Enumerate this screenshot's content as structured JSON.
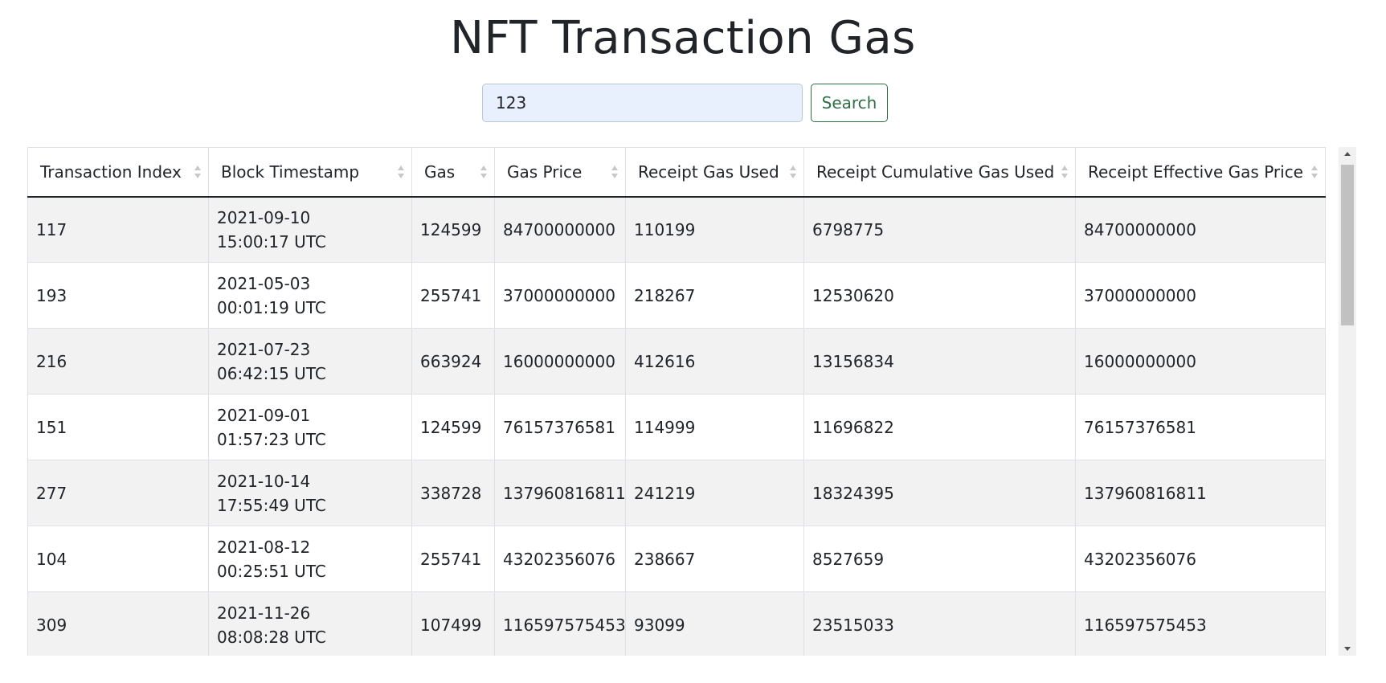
{
  "page": {
    "title": "NFT Transaction Gas"
  },
  "search": {
    "value": "123",
    "button_label": "Search"
  },
  "table": {
    "columns": [
      "Transaction Index",
      "Block Timestamp",
      "Gas",
      "Gas Price",
      "Receipt Gas Used",
      "Receipt Cumulative Gas Used",
      "Receipt Effective Gas Price"
    ],
    "rows": [
      [
        "117",
        "2021-09-10 15:00:17 UTC",
        "124599",
        "84700000000",
        "110199",
        "6798775",
        "84700000000"
      ],
      [
        "193",
        "2021-05-03 00:01:19 UTC",
        "255741",
        "37000000000",
        "218267",
        "12530620",
        "37000000000"
      ],
      [
        "216",
        "2021-07-23 06:42:15 UTC",
        "663924",
        "16000000000",
        "412616",
        "13156834",
        "16000000000"
      ],
      [
        "151",
        "2021-09-01 01:57:23 UTC",
        "124599",
        "76157376581",
        "114999",
        "11696822",
        "76157376581"
      ],
      [
        "277",
        "2021-10-14 17:55:49 UTC",
        "338728",
        "137960816811",
        "241219",
        "18324395",
        "137960816811"
      ],
      [
        "104",
        "2021-08-12 00:25:51 UTC",
        "255741",
        "43202356076",
        "238667",
        "8527659",
        "43202356076"
      ],
      [
        "309",
        "2021-11-26 08:08:28 UTC",
        "107499",
        "116597575453",
        "93099",
        "23515033",
        "116597575453"
      ]
    ]
  },
  "colors": {
    "button_accent": "#2f6e45",
    "input_background": "#e8f0fe",
    "stripe_background": "#f2f2f2"
  },
  "icons": {
    "sort": "sort-both-icon",
    "scroll_up": "scroll-up-arrow-icon",
    "scroll_down": "scroll-down-arrow-icon"
  }
}
